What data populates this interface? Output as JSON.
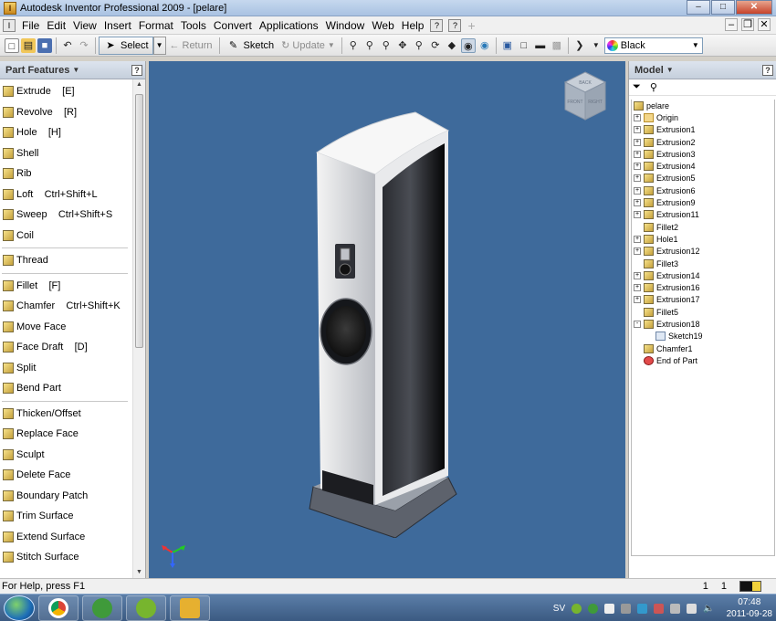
{
  "window": {
    "title": "Autodesk Inventor Professional 2009 - [pelare]"
  },
  "menu": [
    "File",
    "Edit",
    "View",
    "Insert",
    "Format",
    "Tools",
    "Convert",
    "Applications",
    "Window",
    "Web",
    "Help"
  ],
  "toolbar": {
    "select_label": "Select",
    "return_label": "Return",
    "sketch_label": "Sketch",
    "update_label": "Update",
    "color_value": "Black"
  },
  "left_panel": {
    "title": "Part Features",
    "features": [
      {
        "label": "Extrude    [E]"
      },
      {
        "label": "Revolve    [R]"
      },
      {
        "label": "Hole    [H]"
      },
      {
        "label": "Shell"
      },
      {
        "label": "Rib"
      },
      {
        "label": "Loft    Ctrl+Shift+L"
      },
      {
        "label": "Sweep    Ctrl+Shift+S"
      },
      {
        "label": "Coil"
      },
      {
        "label": "Thread"
      },
      {
        "label": "Fillet    [F]"
      },
      {
        "label": "Chamfer    Ctrl+Shift+K"
      },
      {
        "label": "Move Face"
      },
      {
        "label": "Face Draft    [D]"
      },
      {
        "label": "Split"
      },
      {
        "label": "Bend Part"
      },
      {
        "label": "Thicken/Offset"
      },
      {
        "label": "Replace Face"
      },
      {
        "label": "Sculpt"
      },
      {
        "label": "Delete Face"
      },
      {
        "label": "Boundary Patch"
      },
      {
        "label": "Trim Surface"
      },
      {
        "label": "Extend Surface"
      },
      {
        "label": "Stitch Surface"
      }
    ]
  },
  "viewcube": {
    "left_label": "FRONT",
    "right_label": "RIGHT",
    "top_label": "BACK"
  },
  "right_panel": {
    "title": "Model",
    "tree": [
      {
        "label": "pelare",
        "level": 0,
        "icon": "part",
        "expander": ""
      },
      {
        "label": "Origin",
        "level": 1,
        "icon": "folder",
        "expander": "+"
      },
      {
        "label": "Extrusion1",
        "level": 1,
        "icon": "feature",
        "expander": "+"
      },
      {
        "label": "Extrusion2",
        "level": 1,
        "icon": "feature",
        "expander": "+"
      },
      {
        "label": "Extrusion3",
        "level": 1,
        "icon": "feature",
        "expander": "+"
      },
      {
        "label": "Extrusion4",
        "level": 1,
        "icon": "feature",
        "expander": "+"
      },
      {
        "label": "Extrusion5",
        "level": 1,
        "icon": "feature",
        "expander": "+"
      },
      {
        "label": "Extrusion6",
        "level": 1,
        "icon": "feature",
        "expander": "+"
      },
      {
        "label": "Extrusion9",
        "level": 1,
        "icon": "feature",
        "expander": "+"
      },
      {
        "label": "Extrusion11",
        "level": 1,
        "icon": "feature",
        "expander": "+"
      },
      {
        "label": "Fillet2",
        "level": 1,
        "icon": "feature",
        "expander": ""
      },
      {
        "label": "Hole1",
        "level": 1,
        "icon": "feature",
        "expander": "+"
      },
      {
        "label": "Extrusion12",
        "level": 1,
        "icon": "feature",
        "expander": "+"
      },
      {
        "label": "Fillet3",
        "level": 1,
        "icon": "feature",
        "expander": ""
      },
      {
        "label": "Extrusion14",
        "level": 1,
        "icon": "feature",
        "expander": "+"
      },
      {
        "label": "Extrusion16",
        "level": 1,
        "icon": "feature",
        "expander": "+"
      },
      {
        "label": "Extrusion17",
        "level": 1,
        "icon": "feature",
        "expander": "+"
      },
      {
        "label": "Fillet5",
        "level": 1,
        "icon": "feature",
        "expander": ""
      },
      {
        "label": "Extrusion18",
        "level": 1,
        "icon": "feature",
        "expander": "-"
      },
      {
        "label": "Sketch19",
        "level": 2,
        "icon": "sketch",
        "expander": ""
      },
      {
        "label": "Chamfer1",
        "level": 1,
        "icon": "feature",
        "expander": ""
      },
      {
        "label": "End of Part",
        "level": 1,
        "icon": "end",
        "expander": ""
      }
    ]
  },
  "status": {
    "help_text": "For Help, press F1",
    "num1": "1",
    "num2": "1"
  },
  "taskbar": {
    "language": "SV",
    "time": "07:48",
    "date": "2011-09-28",
    "apps": [
      {
        "icon": "chrome-icon",
        "color": "#e0a020"
      },
      {
        "icon": "utorrent-icon",
        "color": "#3f9a3a"
      },
      {
        "icon": "spotify-icon",
        "color": "#77b52e"
      },
      {
        "icon": "inventor-icon",
        "color": "#e6b030"
      }
    ]
  }
}
